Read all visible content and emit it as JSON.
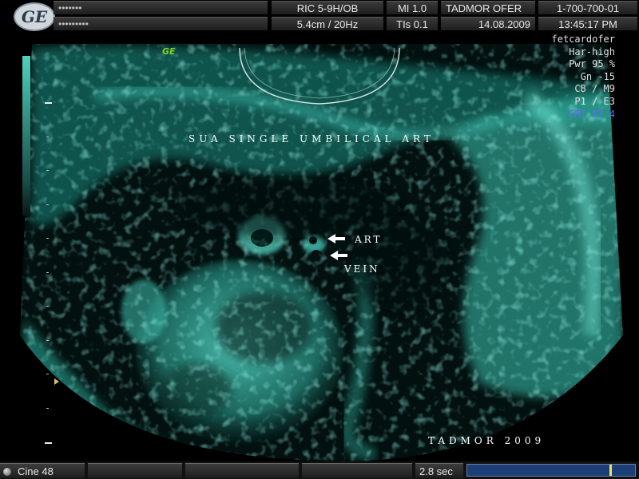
{
  "header": {
    "logo_text": "GE",
    "row1": {
      "dots": "•••••••",
      "probe": "RIC 5-9H/OB",
      "mi": "MI  1.0",
      "patient": "TADMOR  OFER",
      "id": "1-700-700-01"
    },
    "row2": {
      "dots": "•••••••••",
      "depth_freq": "5.4cm / 20Hz",
      "tis": "TIs  0.1",
      "date": "14.08.2009",
      "time": "13:45:17 PM"
    }
  },
  "params": [
    "fetcardofer",
    "Har-high",
    "Pwr  95 %",
    "Gn  -15",
    "C8 / M9",
    "P1 / E3",
    "SRI II 4"
  ],
  "scan": {
    "ge_mark": "GE",
    "title_annotation": "SUA  SINGLE  UMBILICAL   ART",
    "label_art": "ART",
    "label_vein": "VEIN",
    "watermark": "TADMOR   2009"
  },
  "footer": {
    "cine": "Cine 48",
    "duration": "2.8 sec",
    "cine_position": 0.86
  },
  "colors": {
    "tissue": "#4fe0cc",
    "highlight_param": "#5b6bff",
    "ge_mark": "#7cd42b",
    "progress": "#1d3f78",
    "marker": "#f0e35a"
  }
}
